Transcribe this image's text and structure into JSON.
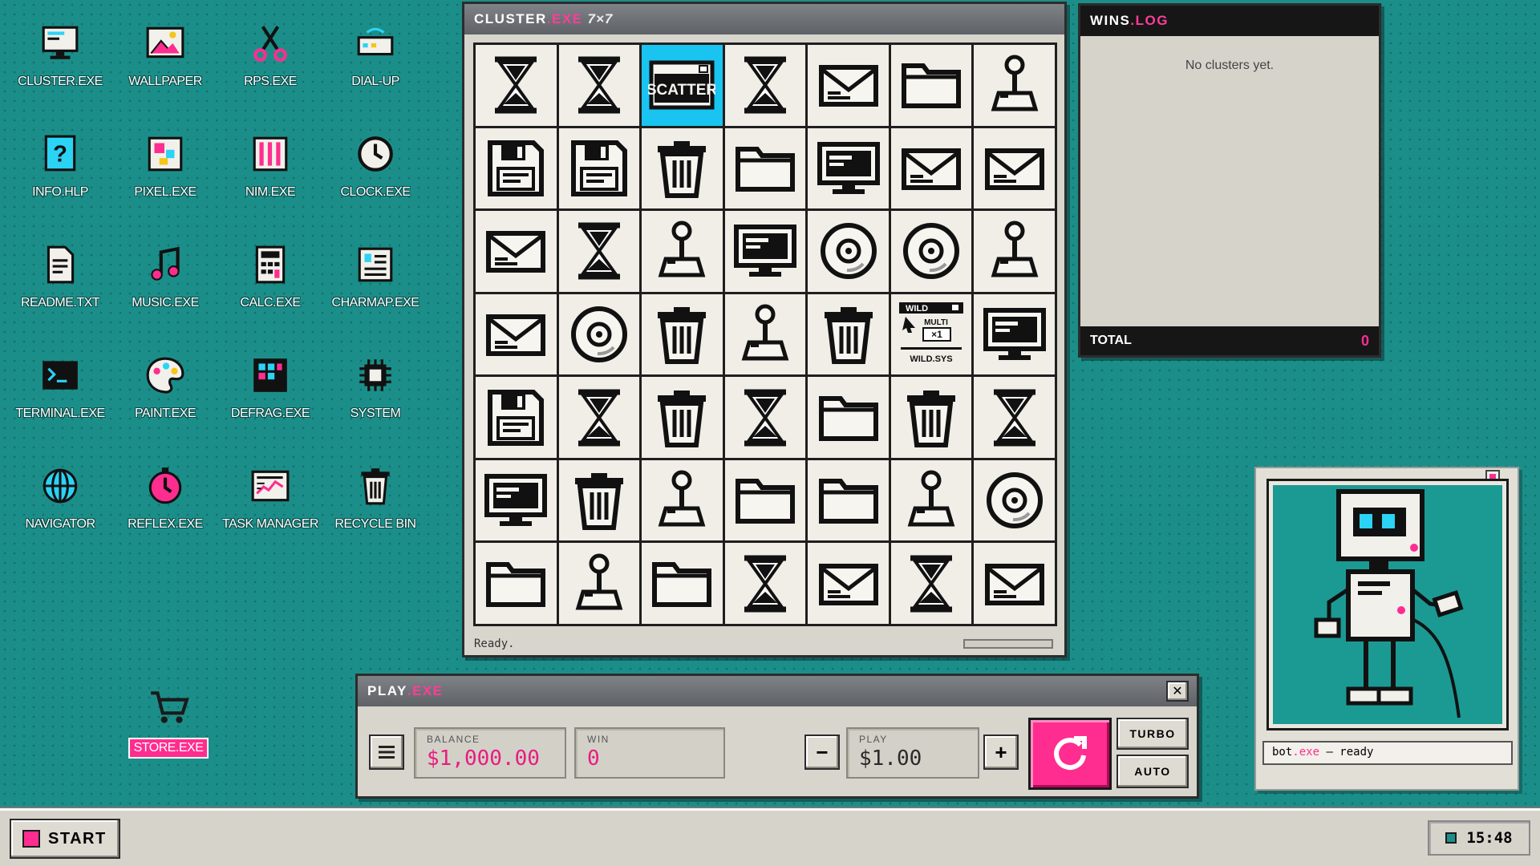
{
  "desktop_icons": [
    {
      "label": "CLUSTER.EXE",
      "icon": "monitor-icon"
    },
    {
      "label": "WALLPAPER",
      "icon": "picture-icon"
    },
    {
      "label": "RPS.EXE",
      "icon": "scissors-icon"
    },
    {
      "label": "DIAL-UP",
      "icon": "modem-icon"
    },
    {
      "label": "INFO.HLP",
      "icon": "help-icon"
    },
    {
      "label": "PIXEL.EXE",
      "icon": "pixel-icon"
    },
    {
      "label": "NIM.EXE",
      "icon": "nim-icon"
    },
    {
      "label": "CLOCK.EXE",
      "icon": "clock-icon"
    },
    {
      "label": "README.TXT",
      "icon": "document-icon"
    },
    {
      "label": "MUSIC.EXE",
      "icon": "music-note-icon"
    },
    {
      "label": "CALC.EXE",
      "icon": "calculator-icon"
    },
    {
      "label": "CHARMAP.EXE",
      "icon": "charmap-icon"
    },
    {
      "label": "TERMINAL.EXE",
      "icon": "terminal-icon"
    },
    {
      "label": "PAINT.EXE",
      "icon": "palette-icon"
    },
    {
      "label": "DEFRAG.EXE",
      "icon": "defrag-icon"
    },
    {
      "label": "SYSTEM",
      "icon": "chip-icon"
    },
    {
      "label": "NAVIGATOR",
      "icon": "globe-icon"
    },
    {
      "label": "REFLEX.EXE",
      "icon": "stopwatch-icon"
    },
    {
      "label": "TASK MANAGER",
      "icon": "task-manager-icon"
    },
    {
      "label": "RECYCLE BIN",
      "icon": "trash-icon"
    }
  ],
  "store": {
    "label": "STORE.EXE",
    "icon": "cart-icon"
  },
  "cluster_window": {
    "title": "CLUSTER",
    "ext": ".EXE",
    "sub": "7×7",
    "status": "Ready."
  },
  "grid_symbols": [
    [
      "hourglass",
      "hourglass",
      "scatter",
      "hourglass",
      "envelope",
      "folder",
      "joystick"
    ],
    [
      "floppy",
      "floppy",
      "trash",
      "folder",
      "monitor",
      "envelope",
      "envelope"
    ],
    [
      "envelope",
      "hourglass",
      "joystick",
      "monitor",
      "disc",
      "disc",
      "joystick"
    ],
    [
      "envelope",
      "disc",
      "trash",
      "joystick",
      "trash",
      "wild",
      "monitor"
    ],
    [
      "floppy",
      "hourglass",
      "trash",
      "hourglass",
      "folder",
      "trash",
      "hourglass"
    ],
    [
      "monitor",
      "trash",
      "joystick",
      "folder",
      "folder",
      "joystick",
      "disc"
    ],
    [
      "folder",
      "joystick",
      "folder",
      "hourglass",
      "envelope",
      "hourglass",
      "envelope"
    ]
  ],
  "scatter_text": "SCATTER",
  "wild": {
    "top": "WILD",
    "multi": "MULTI",
    "mult": "×1",
    "name": "WILD.SYS"
  },
  "wins_window": {
    "title": "WINS",
    "ext": ".LOG",
    "empty": "No clusters yet.",
    "total_label": "TOTAL",
    "total_value": "0"
  },
  "play_window": {
    "title": "PLAY",
    "ext": ".EXE",
    "balance_label": "BALANCE",
    "balance": "$1,000.00",
    "win_label": "WIN",
    "win": "0",
    "play_label": "PLAY",
    "play": "$1.00",
    "minus": "−",
    "plus": "+",
    "turbo": "TURBO",
    "auto": "AUTO",
    "menu_icon": "menu-icon",
    "spin_icon": "refresh-icon"
  },
  "bot": {
    "name": "bot",
    "ext": ".exe",
    "status": " – ready"
  },
  "taskbar": {
    "start": "START",
    "time": "15:48"
  },
  "colors": {
    "desktop": "#1c8e89",
    "accent": "#ff2d8f",
    "selected": "#19c4f0"
  }
}
